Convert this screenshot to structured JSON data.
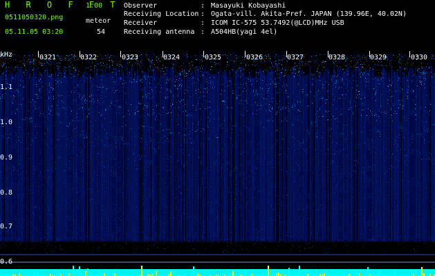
{
  "app": {
    "brand": "H R O F F T",
    "version": "1.00",
    "file": "0511050320.png",
    "date": "05.11.05 03:20",
    "meteor_label": "meteor",
    "meteor_count": "54"
  },
  "info": [
    {
      "label": "Observer",
      "colon": ":",
      "value": "Masayuki Kobayashi"
    },
    {
      "label": "Receiving Location",
      "colon": ":",
      "value": "Ogata-vill. Akita-Pref. JAPAN (139.96E, 40.02N)"
    },
    {
      "label": "Receiver",
      "colon": ":",
      "value": "ICOM IC-575 53.7492(@LCD)MHz USB"
    },
    {
      "label": "Receiving antenna",
      "colon": ":",
      "value": "A504HB(yagi 4el)"
    }
  ],
  "spectrogram": {
    "unit": "kHz",
    "y_ticks": [
      "1.1",
      "1.0",
      "0.9",
      "0.8",
      "0.7",
      "0.6"
    ],
    "time_ticks": [
      "0321",
      "0322",
      "0323",
      "0324",
      "0325",
      "0326",
      "0327",
      "0328",
      "0329",
      "0330"
    ],
    "colors": {
      "background": "#000000",
      "low": "#071b8a",
      "mid": "#1a61ff",
      "high": "#00c6ff",
      "peak": "#ffff00",
      "baseline": "#00ffff"
    }
  }
}
